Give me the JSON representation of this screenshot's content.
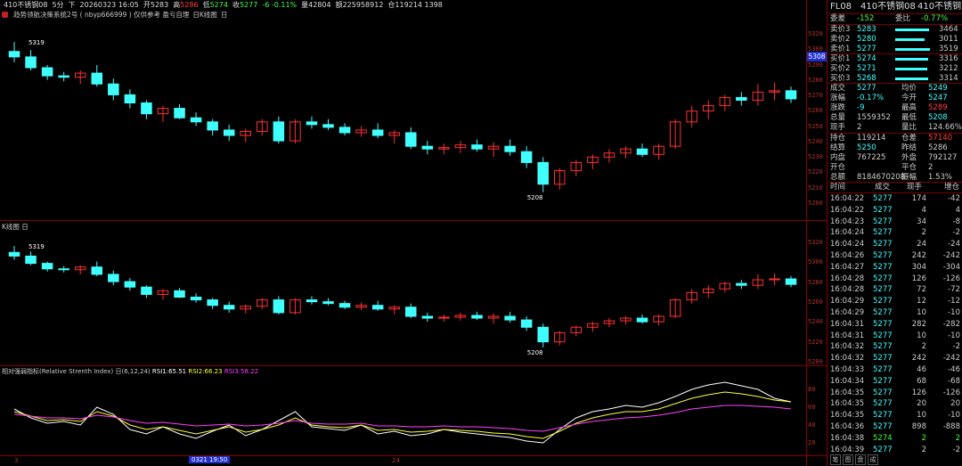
{
  "header": {
    "symbol": "410不锈钢08",
    "period": "5分",
    "dir": "下",
    "time": "20260323 16:05",
    "open_label": "开",
    "open": "5283",
    "high_label": "高",
    "high": "5286",
    "low_label": "低",
    "low": "5274",
    "close_label": "收",
    "close": "5277",
    "change": "-6 -0.11%",
    "vol_label": "量",
    "vol": "42804",
    "amt_label": "额",
    "amt": "225958912",
    "oi_label": "仓",
    "oi": "119214 1398"
  },
  "sub_header": {
    "system": "趋势领航决策系统2号 ( nbyp666999 ) 仅供参考 盈亏自理",
    "chart_tag": "日K线图",
    "menu": "日"
  },
  "panel2_title": "K线图 日",
  "rsi": {
    "title": "相对强弱指标(Relative Strenth Index) 日(6,12,24)",
    "rsi1_label": "RSI1:",
    "rsi1": "65.51",
    "rsi2_label": "RSI2:",
    "rsi2": "66.23",
    "rsi3_label": "RSI3:",
    "rsi3": "58.22",
    "colors": {
      "rsi1": "#ffffff",
      "rsi2": "#ffff40",
      "rsi3": "#ff40ff"
    }
  },
  "xaxis": {
    "left": "3",
    "cursor": "0321 19:50",
    "mid": "24"
  },
  "price_tag": "5308",
  "annotations": {
    "high": "5319",
    "low": "5208"
  },
  "main_axis": [
    "5320",
    "5300",
    "5290",
    "5280",
    "5270",
    "5260",
    "5250",
    "5240",
    "5230",
    "5220",
    "5210",
    "5200"
  ],
  "panel2_axis": [
    "5320",
    "5300",
    "5280",
    "5260",
    "5240",
    "5220",
    "5200"
  ],
  "rsi_axis": [
    "80",
    "60",
    "40",
    "20"
  ],
  "right_panel": {
    "title_left": "FL08",
    "title_mid": "410不锈钢08",
    "title_right": "410不锈钢",
    "weicha_label": "委差",
    "weicha": "-152",
    "weibi_label": "委比",
    "weibi": "-0.77%",
    "asks": [
      {
        "label": "卖价3",
        "price": "5283",
        "vol": "3464"
      },
      {
        "label": "卖价2",
        "price": "5280",
        "vol": "3011"
      },
      {
        "label": "卖价1",
        "price": "5277",
        "vol": "3519"
      }
    ],
    "bids": [
      {
        "label": "买价1",
        "price": "5274",
        "vol": "3316"
      },
      {
        "label": "买价2",
        "price": "5271",
        "vol": "3212"
      },
      {
        "label": "买价3",
        "price": "5268",
        "vol": "3314"
      }
    ],
    "stats": [
      {
        "l1": "成交",
        "v1": "5277",
        "l2": "均价",
        "v2": "5249"
      },
      {
        "l1": "涨幅",
        "v1": "-0.17%",
        "l2": "今开",
        "v2": "5247"
      },
      {
        "l1": "涨跌",
        "v1": "-9",
        "l2": "最高",
        "v2": "5289"
      },
      {
        "l1": "总量",
        "v1": "1559352",
        "l2": "最低",
        "v2": "5208"
      },
      {
        "l1": "现手",
        "v1": "2",
        "l2": "量比",
        "v2": "124.66%"
      }
    ],
    "stats2": [
      {
        "l1": "持仓",
        "v1": "119214",
        "l2": "仓差",
        "v2": "57140"
      },
      {
        "l1": "结算",
        "v1": "5250",
        "l2": "昨结",
        "v2": "5286"
      },
      {
        "l1": "内盘",
        "v1": "767225",
        "l2": "外盘",
        "v2": "792127"
      },
      {
        "l1": "开仓",
        "v1": "",
        "l2": "平仓",
        "v2": "2"
      },
      {
        "l1": "总额",
        "v1": "8184670208",
        "l2": "振幅",
        "v2": "1.53%"
      }
    ],
    "tick_header": {
      "time": "时间",
      "price": "成交",
      "qty": "现手",
      "oi": "增仓"
    },
    "ticks": [
      {
        "time": "16:04:22",
        "price": "5277",
        "qty": "174",
        "oi": "-42"
      },
      {
        "time": "16:04:22",
        "price": "5277",
        "qty": "4",
        "oi": "4"
      },
      {
        "time": "16:04:23",
        "price": "5277",
        "qty": "34",
        "oi": "-8"
      },
      {
        "time": "16:04:24",
        "price": "5277",
        "qty": "2",
        "oi": "-2"
      },
      {
        "time": "16:04:24",
        "price": "5277",
        "qty": "24",
        "oi": "-24"
      },
      {
        "time": "16:04:26",
        "price": "5277",
        "qty": "242",
        "oi": "-242"
      },
      {
        "time": "16:04:27",
        "price": "5277",
        "qty": "304",
        "oi": "-304"
      },
      {
        "time": "16:04:28",
        "price": "5277",
        "qty": "126",
        "oi": "-126"
      },
      {
        "time": "16:04:28",
        "price": "5277",
        "qty": "72",
        "oi": "-72"
      },
      {
        "time": "16:04:29",
        "price": "5277",
        "qty": "12",
        "oi": "-12"
      },
      {
        "time": "16:04:29",
        "price": "5277",
        "qty": "10",
        "oi": "-10"
      },
      {
        "time": "16:04:31",
        "price": "5277",
        "qty": "282",
        "oi": "-282"
      },
      {
        "time": "16:04:31",
        "price": "5277",
        "qty": "10",
        "oi": "-10"
      },
      {
        "time": "16:04:32",
        "price": "5277",
        "qty": "2",
        "oi": "-2"
      },
      {
        "time": "16:04:32",
        "price": "5277",
        "qty": "242",
        "oi": "-242"
      },
      {
        "time": "16:04:33",
        "price": "5277",
        "qty": "46",
        "oi": "-46"
      },
      {
        "time": "16:04:34",
        "price": "5277",
        "qty": "68",
        "oi": "-68"
      },
      {
        "time": "16:04:35",
        "price": "5277",
        "qty": "126",
        "oi": "-126"
      },
      {
        "time": "16:04:35",
        "price": "5277",
        "qty": "20",
        "oi": "20"
      },
      {
        "time": "16:04:35",
        "price": "5277",
        "qty": "10",
        "oi": "-10"
      },
      {
        "time": "16:04:36",
        "price": "5277",
        "qty": "898",
        "oi": "-888"
      },
      {
        "time": "16:04:38",
        "price": "5274",
        "qty": "2",
        "oi": "2"
      },
      {
        "time": "16:04:39",
        "price": "5277",
        "qty": "2",
        "oi": "-2"
      }
    ],
    "bottom_tabs": [
      "笔",
      "图",
      "盘",
      "成"
    ]
  },
  "chart_data": {
    "type": "candlestick",
    "candles": [
      [
        5312,
        5319,
        5304,
        5308
      ],
      [
        5308,
        5313,
        5298,
        5300
      ],
      [
        5300,
        5302,
        5291,
        5294
      ],
      [
        5294,
        5297,
        5290,
        5293
      ],
      [
        5293,
        5298,
        5288,
        5296
      ],
      [
        5296,
        5302,
        5286,
        5288
      ],
      [
        5288,
        5292,
        5276,
        5280
      ],
      [
        5280,
        5284,
        5270,
        5274
      ],
      [
        5274,
        5276,
        5262,
        5266
      ],
      [
        5266,
        5272,
        5260,
        5270
      ],
      [
        5270,
        5273,
        5262,
        5263
      ],
      [
        5263,
        5267,
        5257,
        5260
      ],
      [
        5260,
        5262,
        5250,
        5254
      ],
      [
        5254,
        5258,
        5246,
        5250
      ],
      [
        5250,
        5255,
        5245,
        5253
      ],
      [
        5253,
        5262,
        5250,
        5260
      ],
      [
        5260,
        5264,
        5244,
        5246
      ],
      [
        5246,
        5262,
        5244,
        5260
      ],
      [
        5260,
        5264,
        5255,
        5258
      ],
      [
        5258,
        5262,
        5254,
        5256
      ],
      [
        5256,
        5259,
        5250,
        5252
      ],
      [
        5252,
        5257,
        5249,
        5254
      ],
      [
        5254,
        5259,
        5248,
        5250
      ],
      [
        5250,
        5254,
        5244,
        5252
      ],
      [
        5252,
        5256,
        5240,
        5242
      ],
      [
        5242,
        5246,
        5236,
        5240
      ],
      [
        5240,
        5244,
        5236,
        5241
      ],
      [
        5241,
        5246,
        5237,
        5243
      ],
      [
        5243,
        5247,
        5238,
        5240
      ],
      [
        5240,
        5245,
        5234,
        5242
      ],
      [
        5242,
        5247,
        5235,
        5238
      ],
      [
        5238,
        5242,
        5226,
        5230
      ],
      [
        5230,
        5234,
        5208,
        5214
      ],
      [
        5214,
        5226,
        5210,
        5224
      ],
      [
        5224,
        5232,
        5220,
        5230
      ],
      [
        5230,
        5236,
        5225,
        5234
      ],
      [
        5234,
        5240,
        5230,
        5237
      ],
      [
        5237,
        5242,
        5233,
        5240
      ],
      [
        5240,
        5244,
        5234,
        5236
      ],
      [
        5236,
        5244,
        5232,
        5242
      ],
      [
        5242,
        5262,
        5240,
        5260
      ],
      [
        5260,
        5272,
        5256,
        5268
      ],
      [
        5268,
        5276,
        5262,
        5272
      ],
      [
        5272,
        5280,
        5268,
        5278
      ],
      [
        5278,
        5282,
        5272,
        5276
      ],
      [
        5276,
        5288,
        5272,
        5282
      ],
      [
        5282,
        5289,
        5276,
        5283
      ],
      [
        5283,
        5286,
        5274,
        5277
      ]
    ],
    "rsi1": [
      58,
      48,
      42,
      44,
      40,
      60,
      52,
      35,
      30,
      38,
      30,
      25,
      33,
      40,
      28,
      35,
      45,
      55,
      38,
      36,
      34,
      40,
      30,
      33,
      28,
      30,
      35,
      32,
      30,
      28,
      26,
      22,
      20,
      35,
      48,
      55,
      58,
      62,
      60,
      65,
      72,
      80,
      85,
      88,
      84,
      80,
      70,
      66
    ],
    "rsi2": [
      55,
      50,
      45,
      46,
      44,
      55,
      50,
      40,
      35,
      38,
      34,
      30,
      34,
      38,
      32,
      35,
      40,
      48,
      40,
      38,
      37,
      40,
      34,
      35,
      32,
      33,
      35,
      34,
      33,
      31,
      30,
      27,
      25,
      33,
      42,
      48,
      52,
      55,
      55,
      58,
      64,
      70,
      74,
      77,
      75,
      72,
      68,
      66
    ],
    "rsi3": [
      52,
      50,
      48,
      48,
      47,
      51,
      49,
      45,
      42,
      43,
      41,
      39,
      40,
      41,
      39,
      40,
      42,
      45,
      42,
      41,
      41,
      42,
      39,
      39,
      38,
      38,
      39,
      38,
      38,
      37,
      36,
      34,
      33,
      37,
      41,
      44,
      46,
      48,
      49,
      51,
      54,
      58,
      60,
      62,
      62,
      61,
      60,
      58
    ],
    "ylim": [
      5200,
      5325
    ]
  }
}
